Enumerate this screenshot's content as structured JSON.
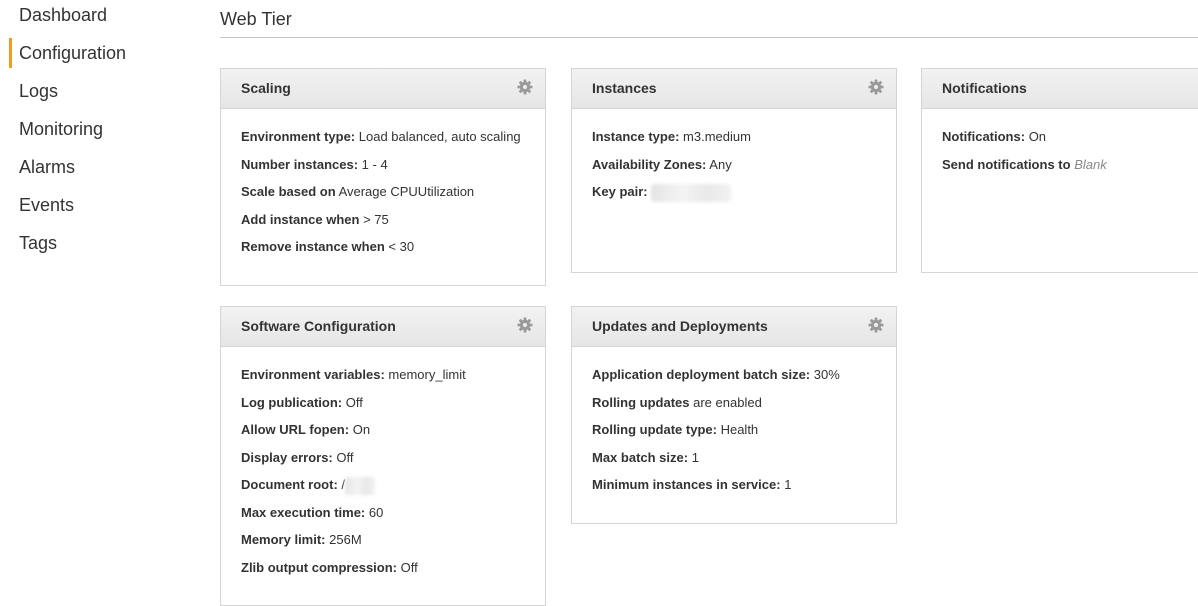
{
  "sidebar": {
    "items": [
      {
        "label": "Dashboard",
        "active": false
      },
      {
        "label": "Configuration",
        "active": true
      },
      {
        "label": "Logs",
        "active": false
      },
      {
        "label": "Monitoring",
        "active": false
      },
      {
        "label": "Alarms",
        "active": false
      },
      {
        "label": "Events",
        "active": false
      },
      {
        "label": "Tags",
        "active": false
      }
    ]
  },
  "page": {
    "title": "Web Tier"
  },
  "colors": {
    "accent": "#f29b1d",
    "panel_header": "#ebebeb",
    "border": "#d5d5d5"
  },
  "panels": {
    "scaling": {
      "title": "Scaling",
      "rows": [
        {
          "label": "Environment type:",
          "value": "Load balanced, auto scaling"
        },
        {
          "label": "Number instances:",
          "value": "1 - 4"
        },
        {
          "label": "Scale based on",
          "value": "Average CPUUtilization"
        },
        {
          "label": "Add instance when",
          "value": "> 75"
        },
        {
          "label": "Remove instance when",
          "value": "< 30"
        }
      ]
    },
    "instances": {
      "title": "Instances",
      "rows": [
        {
          "label": "Instance type:",
          "value": "m3.medium"
        },
        {
          "label": "Availability Zones:",
          "value": "Any"
        },
        {
          "label": "Key pair:",
          "value": ""
        }
      ]
    },
    "notifications": {
      "title": "Notifications",
      "rows": [
        {
          "label": "Notifications:",
          "value": "On"
        },
        {
          "label": "Send notifications to",
          "value": "Blank"
        }
      ]
    },
    "software": {
      "title": "Software Configuration",
      "rows": [
        {
          "label": "Environment variables:",
          "value": "memory_limit"
        },
        {
          "label": "Log publication:",
          "value": "Off"
        },
        {
          "label": "Allow URL fopen:",
          "value": "On"
        },
        {
          "label": "Display errors:",
          "value": "Off"
        },
        {
          "label": "Document root:",
          "value": "/"
        },
        {
          "label": "Max execution time:",
          "value": "60"
        },
        {
          "label": "Memory limit:",
          "value": "256M"
        },
        {
          "label": "Zlib output compression:",
          "value": "Off"
        }
      ]
    },
    "updates": {
      "title": "Updates and Deployments",
      "rows": [
        {
          "label": "Application deployment batch size:",
          "value": "30%"
        },
        {
          "label": "Rolling updates",
          "value": "are enabled"
        },
        {
          "label": "Rolling update type:",
          "value": "Health"
        },
        {
          "label": "Max batch size:",
          "value": "1"
        },
        {
          "label": "Minimum instances in service:",
          "value": "1"
        }
      ]
    }
  }
}
